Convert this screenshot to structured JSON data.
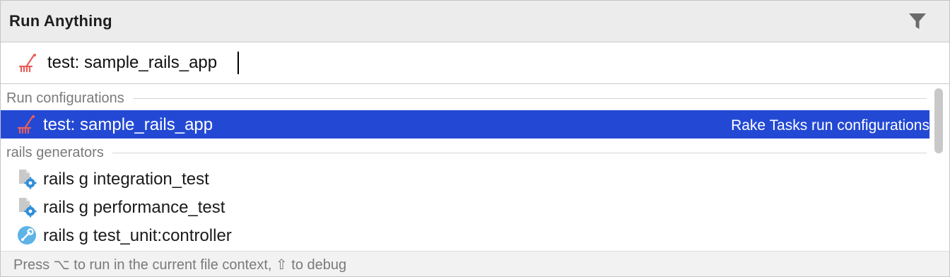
{
  "header": {
    "title": "Run Anything",
    "filter_icon": "filter-icon"
  },
  "search": {
    "value": "test: sample_rails_app",
    "icon": "rake-task-icon",
    "icon_color": "#e8605a"
  },
  "sections": [
    {
      "label": "Run configurations",
      "items": [
        {
          "label": "test: sample_rails_app",
          "detail": "Rake Tasks run configurations",
          "icon": "rake-task-icon",
          "selected": true
        }
      ]
    },
    {
      "label": "rails generators",
      "items": [
        {
          "label": "rails g integration_test",
          "icon": "generator-file-gear-icon"
        },
        {
          "label": "rails g performance_test",
          "icon": "generator-file-gear-icon"
        },
        {
          "label": "rails g test_unit:controller",
          "icon": "wrench-circle-icon"
        }
      ]
    }
  ],
  "footer": {
    "hint": "Press ⌥ to run in the current file context, ⇧ to debug"
  },
  "colors": {
    "selection": "#2349d4",
    "accent_icon": "#e8605a",
    "gear_blue": "#2f8fd8"
  }
}
